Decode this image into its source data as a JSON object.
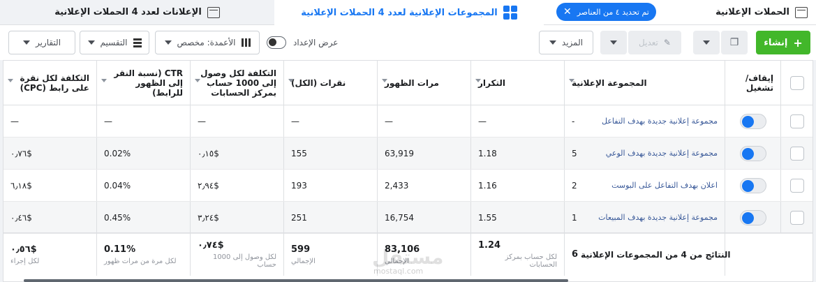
{
  "tabs": {
    "campaigns": {
      "label": "الحملات الإعلانية"
    },
    "campaigns_chip": {
      "label": "تم تحديد ٤ من العناصر"
    },
    "adsets": {
      "label": "المجموعات الإعلانية لعدد 4 الحملات الإعلانية"
    },
    "ads": {
      "label": "الإعلانات لعدد 4 الحملات الإعلانية"
    }
  },
  "toolbar": {
    "create_label": "إنشاء",
    "edit_label": "تعديل",
    "more_label": "المزيد",
    "view_setup_label": "عرض الإعداد",
    "columns_label": "الأعمدة: مخصص",
    "breakdown_label": "التقسيم",
    "reports_label": "التقارير"
  },
  "table": {
    "headers": {
      "toggle": "إيقاف/ تشغيل",
      "name": "المجموعة الإعلانية",
      "frequency": "التكرار",
      "impressions": "مرات الظهور",
      "clicks": "نقرات (الكل)",
      "cost_per_1000": "التكلفة لكل وصول إلى 1000 حساب بمركز الحسابات",
      "ctr": "CTR (نسبة النقر إلى الظهور للرابط)",
      "cpc": "التكلفة لكل نقرة على رابط (CPC)"
    },
    "rows": [
      {
        "name": "مجموعة إعلانية جديدة بهدف التفاعل",
        "idx": "-",
        "frequency": "—",
        "impressions": "—",
        "clicks": "—",
        "cost_per_1000": "—",
        "ctr": "—",
        "cpc": "—"
      },
      {
        "name": "مجموعة إعلانية جديدة بهدف الوعي",
        "idx": "5",
        "frequency": "1.18",
        "impressions": "63,919",
        "clicks": "155",
        "cost_per_1000": "٠٫١٥$",
        "ctr": "0.02%",
        "cpc": "٠٫٧٦$"
      },
      {
        "name": "اعلان بهدف التفاعل على البوست",
        "idx": "2",
        "frequency": "1.16",
        "impressions": "2,433",
        "clicks": "193",
        "cost_per_1000": "٢٫٩٤$",
        "ctr": "0.04%",
        "cpc": "٦٫١٨$"
      },
      {
        "name": "مجموعة إعلانية جديدة بهدف المبيعات",
        "idx": "1",
        "frequency": "1.55",
        "impressions": "16,754",
        "clicks": "251",
        "cost_per_1000": "٣٫٢٤$",
        "ctr": "0.45%",
        "cpc": "٠٫٤٦$"
      }
    ],
    "footer": {
      "name": "النتائج من 4 من المجموعات الإعلانية",
      "idx": "6",
      "frequency": "1.24",
      "frequency_sub": "لكل حساب بمركز الحسابات",
      "impressions": "83,106",
      "impressions_sub": "الإجمالي",
      "clicks": "599",
      "clicks_sub": "الإجمالي",
      "cost_per_1000": "٠٫٧٤$",
      "cost_per_1000_sub": "لكل وصول إلى 1000 حساب",
      "ctr": "0.11%",
      "ctr_sub": "لكل مرة من مرات ظهور",
      "cpc": "٠٫٥٦$",
      "cpc_sub": "لكل إجراء"
    }
  },
  "watermark": {
    "text": "مستقل",
    "sub": "mostaql.com"
  },
  "colors": {
    "accent": "#1877f2",
    "create": "#42b72a",
    "link": "#385898"
  }
}
